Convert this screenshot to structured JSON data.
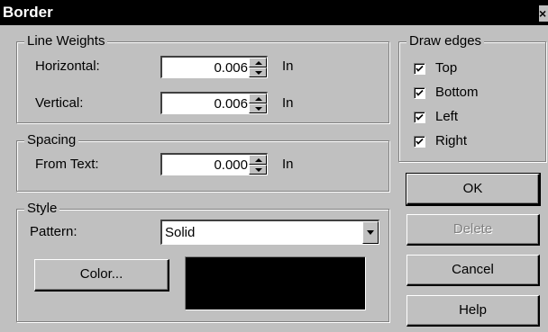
{
  "window": {
    "title": "Border",
    "close_glyph": "×"
  },
  "line_weights": {
    "legend": "Line Weights",
    "horizontal": {
      "label": "Horizontal:",
      "value": "0.006",
      "unit": "In"
    },
    "vertical": {
      "label": "Vertical:",
      "value": "0.006",
      "unit": "In"
    }
  },
  "spacing": {
    "legend": "Spacing",
    "from_text": {
      "label": "From Text:",
      "value": "0.000",
      "unit": "In"
    }
  },
  "style": {
    "legend": "Style",
    "pattern_label": "Pattern:",
    "pattern_value": "Solid",
    "color_button": "Color...",
    "color_value": "#000000"
  },
  "draw_edges": {
    "legend": "Draw edges",
    "items": [
      {
        "label": "Top",
        "checked": true
      },
      {
        "label": "Bottom",
        "checked": true
      },
      {
        "label": "Left",
        "checked": true
      },
      {
        "label": "Right",
        "checked": true
      }
    ]
  },
  "buttons": {
    "ok": "OK",
    "delete": "Delete",
    "cancel": "Cancel",
    "help": "Help"
  }
}
